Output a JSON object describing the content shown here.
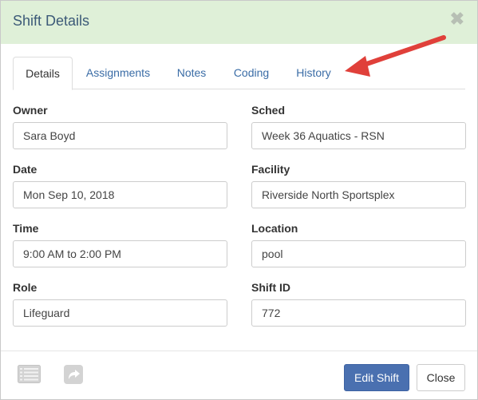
{
  "dialog": {
    "title": "Shift Details",
    "close_symbol": "✖"
  },
  "tabs": [
    {
      "label": "Details",
      "active": true
    },
    {
      "label": "Assignments",
      "active": false
    },
    {
      "label": "Notes",
      "active": false
    },
    {
      "label": "Coding",
      "active": false
    },
    {
      "label": "History",
      "active": false
    }
  ],
  "fields": {
    "owner": {
      "label": "Owner",
      "value": "Sara Boyd"
    },
    "sched": {
      "label": "Sched",
      "value": "Week 36 Aquatics - RSN"
    },
    "date": {
      "label": "Date",
      "value": "Mon Sep 10, 2018"
    },
    "facility": {
      "label": "Facility",
      "value": "Riverside North Sportsplex"
    },
    "time": {
      "label": "Time",
      "value": "9:00 AM to 2:00 PM"
    },
    "location": {
      "label": "Location",
      "value": "pool"
    },
    "role": {
      "label": "Role",
      "value": "Lifeguard"
    },
    "shift_id": {
      "label": "Shift ID",
      "value": "772"
    }
  },
  "footer": {
    "edit_label": "Edit Shift",
    "close_label": "Close",
    "icons": [
      "list-icon",
      "share-arrow-icon"
    ]
  },
  "colors": {
    "header_bg": "#dff0d8",
    "primary_button": "#4a70b0",
    "annotation_arrow": "#e0403a"
  }
}
